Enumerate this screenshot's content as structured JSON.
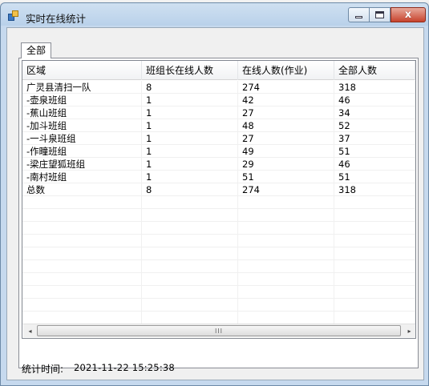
{
  "window": {
    "title": "实时在线统计",
    "minimize_glyph": "",
    "close_glyph": "x"
  },
  "tabs": [
    {
      "label": "全部",
      "selected": true
    }
  ],
  "table": {
    "columns": [
      "区域",
      "班组长在线人数",
      "在线人数(作业)",
      "全部人数"
    ],
    "rows": [
      [
        "广灵县清扫一队",
        "8",
        "274",
        "318"
      ],
      [
        "-壶泉班组",
        "1",
        "42",
        "46"
      ],
      [
        "-蕉山班组",
        "1",
        "27",
        "34"
      ],
      [
        "-加斗班组",
        "1",
        "48",
        "52"
      ],
      [
        "-一斗泉班组",
        "1",
        "27",
        "37"
      ],
      [
        "-作疃班组",
        "1",
        "49",
        "51"
      ],
      [
        "-梁庄望狐班组",
        "1",
        "29",
        "46"
      ],
      [
        "-南村班组",
        "1",
        "51",
        "51"
      ],
      [
        "总数",
        "8",
        "274",
        "318"
      ]
    ]
  },
  "scrollbar": {
    "left_arrow": "◂",
    "right_arrow": "▸",
    "grip": "III"
  },
  "footer": {
    "label": "统计时间:",
    "timestamp": "2021-11-22 15:25:38"
  }
}
